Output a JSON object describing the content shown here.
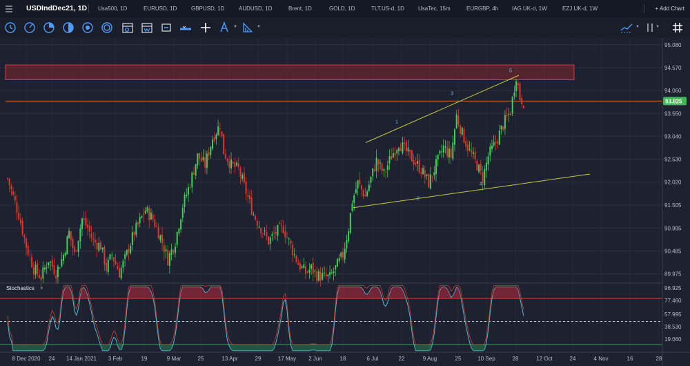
{
  "tabs": {
    "active": "USDIndDec21, 1D",
    "items": [
      "Usa500, 1D",
      "EURUSD, 1D",
      "GBPUSD, 1D",
      "AUDUSD, 1D",
      "Brent, 1D",
      "GOLD, 1D",
      "TLT.US-d, 1D",
      "UsaTec, 15m",
      "EURGBP, 4h",
      "IAG.UK-d, 1W",
      "EZJ.UK-d, 1W"
    ],
    "add_chart": "+ Add Chart"
  },
  "toolbar": {
    "icons": [
      "clock-icon",
      "compass-icon",
      "pie-icon",
      "half-circle-icon",
      "circle-dot-icon",
      "target-icon",
      "calendar-icon",
      "calendar-window-icon",
      "ruler-icon",
      "crosshair-icon",
      "pen-icon",
      "fib-icon",
      "line-style-icon",
      "grid-icon"
    ]
  },
  "chart_data": {
    "type": "candlestick",
    "symbol": "USDIndDec21",
    "timeframe": "1D",
    "price_axis": {
      "labels": [
        "95.080",
        "94.570",
        "94.060",
        "93.550",
        "93.040",
        "92.530",
        "92.020",
        "91.505",
        "90.995",
        "90.485",
        "89.975"
      ],
      "range": [
        89.8,
        95.2
      ]
    },
    "current_price": "93.825",
    "x_axis_labels": [
      "8 Dec 2020",
      "24",
      "14 Jan 2021",
      "3 Feb",
      "19",
      "9 Mar",
      "25",
      "13 Apr",
      "29",
      "17 May",
      "2 Jun",
      "18",
      "6 Jul",
      "22",
      "9 Aug",
      "25",
      "10 Sep",
      "28",
      "12 Oct",
      "24",
      "4 Nov",
      "16",
      "28"
    ],
    "wave_labels": [
      "1",
      "2",
      "3",
      "4",
      "5"
    ],
    "resistance_zone": [
      94.3,
      94.63
    ],
    "horizontal_level": 93.825,
    "stochastics": {
      "title": "Stochastics",
      "axis_labels": [
        "96.925",
        "77.460",
        "57.995",
        "38.530",
        "19.060"
      ],
      "range": [
        10,
        100
      ],
      "levels": [
        80,
        50,
        20
      ]
    },
    "close_points": [
      [
        0,
        92.1
      ],
      [
        6,
        91.3
      ],
      [
        10,
        90.6
      ],
      [
        14,
        90.1
      ],
      [
        18,
        89.9
      ],
      [
        22,
        90.3
      ],
      [
        26,
        90.0
      ],
      [
        30,
        90.4
      ],
      [
        33,
        90.9
      ],
      [
        36,
        90.4
      ],
      [
        40,
        91.2
      ],
      [
        43,
        91.0
      ],
      [
        46,
        90.7
      ],
      [
        50,
        90.6
      ],
      [
        53,
        90.1
      ],
      [
        56,
        90.4
      ],
      [
        60,
        90.0
      ],
      [
        63,
        90.3
      ],
      [
        65,
        90.55
      ],
      [
        68,
        90.9
      ],
      [
        71,
        91.15
      ],
      [
        74,
        91.4
      ],
      [
        78,
        91.2
      ],
      [
        82,
        90.8
      ],
      [
        86,
        90.3
      ],
      [
        90,
        90.7
      ],
      [
        94,
        91.5
      ],
      [
        98,
        92.0
      ],
      [
        102,
        92.6
      ],
      [
        106,
        92.4
      ],
      [
        110,
        93.0
      ],
      [
        114,
        93.3
      ],
      [
        116,
        92.7
      ],
      [
        120,
        92.4
      ],
      [
        124,
        92.3
      ],
      [
        128,
        91.8
      ],
      [
        132,
        91.3
      ],
      [
        136,
        91.0
      ],
      [
        140,
        90.7
      ],
      [
        144,
        90.9
      ],
      [
        148,
        91.0
      ],
      [
        152,
        90.6
      ],
      [
        156,
        90.2
      ],
      [
        160,
        90.0
      ],
      [
        163,
        90.1
      ],
      [
        166,
        89.95
      ],
      [
        170,
        89.9
      ],
      [
        173,
        89.9
      ],
      [
        176,
        90.1
      ],
      [
        180,
        90.4
      ],
      [
        183,
        91.0
      ],
      [
        185,
        91.6
      ],
      [
        188,
        92.0
      ],
      [
        192,
        91.7
      ],
      [
        195,
        92.1
      ],
      [
        198,
        92.5
      ],
      [
        202,
        92.2
      ],
      [
        206,
        92.6
      ],
      [
        210,
        92.9
      ],
      [
        214,
        92.7
      ],
      [
        218,
        92.5
      ],
      [
        222,
        92.3
      ],
      [
        226,
        92.0
      ],
      [
        230,
        92.4
      ],
      [
        234,
        92.8
      ],
      [
        238,
        92.6
      ],
      [
        241,
        93.5
      ],
      [
        244,
        93.1
      ],
      [
        248,
        92.7
      ],
      [
        252,
        92.4
      ],
      [
        255,
        92.1
      ],
      [
        258,
        92.6
      ],
      [
        262,
        92.9
      ],
      [
        266,
        93.3
      ],
      [
        270,
        93.6
      ],
      [
        273,
        94.4
      ],
      [
        275,
        93.9
      ],
      [
        277,
        93.8
      ]
    ]
  }
}
